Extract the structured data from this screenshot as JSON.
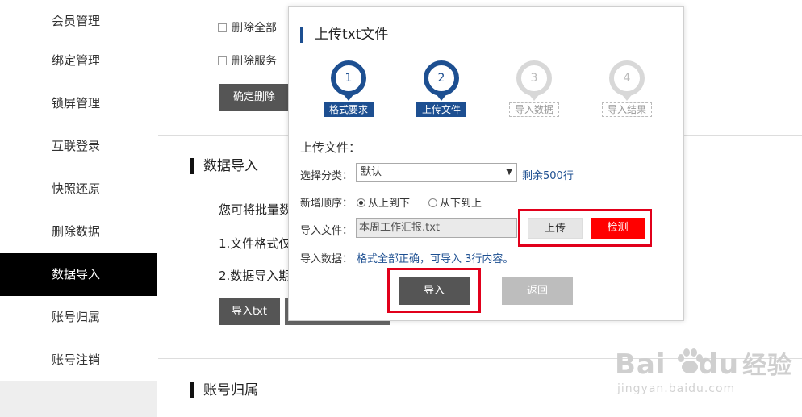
{
  "sidebar": {
    "items": [
      {
        "label": "会员管理"
      },
      {
        "label": "绑定管理"
      },
      {
        "label": "锁屏管理"
      },
      {
        "label": "互联登录"
      },
      {
        "label": "快照还原"
      },
      {
        "label": "删除数据"
      },
      {
        "label": "数据导入"
      },
      {
        "label": "账号归属"
      },
      {
        "label": "账号注销"
      }
    ],
    "active_index": 6
  },
  "main": {
    "checkbox_1": "删除全部",
    "checkbox_2": "删除服务",
    "confirm_delete": "确定删除",
    "section_import": "数据导入",
    "text_1": "您可将批量数",
    "text_2": "1.文件格式仅",
    "text_3": "2.数据导入期",
    "import_txt_button": "导入txt",
    "section_account": "账号归属"
  },
  "modal": {
    "title": "上传txt文件",
    "steps": [
      {
        "num": "1",
        "label": "格式要求",
        "state": "active"
      },
      {
        "num": "2",
        "label": "上传文件",
        "state": "active"
      },
      {
        "num": "3",
        "label": "导入数据",
        "state": "inactive"
      },
      {
        "num": "4",
        "label": "导入结果",
        "state": "inactive"
      }
    ],
    "upload_heading": "上传文件：",
    "category_label": "选择分类：",
    "category_value": "默认",
    "remaining": "剩余500行",
    "order_label": "新增顺序：",
    "order_option_1": "从上到下",
    "order_option_2": "从下到上",
    "file_label": "导入文件：",
    "file_value": "本周工作汇报.txt",
    "upload_button": "上传",
    "detect_button": "检测",
    "data_label": "导入数据：",
    "data_result": "格式全部正确，可导入 3行内容。",
    "import_button": "导入",
    "back_button": "返回"
  },
  "watermark": {
    "brand": "Bai",
    "brand_tail": "du",
    "cn": "经验",
    "url": "jingyan.baidu.com"
  },
  "colors": {
    "accent": "#1d4f91",
    "highlight_frame": "#e1001b",
    "detect": "#ff0000"
  }
}
